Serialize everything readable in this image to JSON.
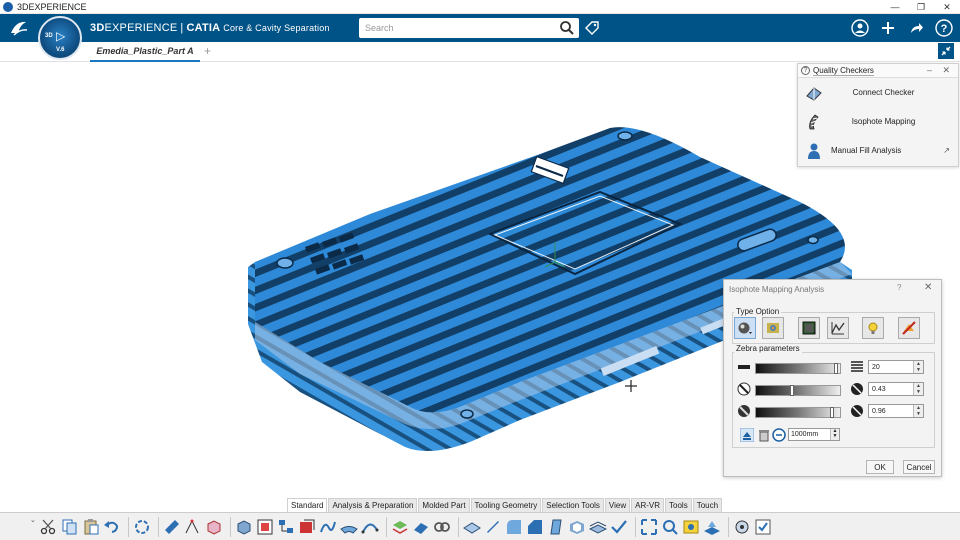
{
  "os": {
    "title": "3DEXPERIENCE",
    "controls": [
      "—",
      "❐",
      "✕"
    ]
  },
  "header": {
    "logo_text": "3DS",
    "compass": {
      "label_3d": "3D",
      "version": "V.6"
    },
    "brand_bold": "3D",
    "brand_rest": "EXPERIENCE",
    "brand_sep": "|",
    "brand_product": "CATIA",
    "app_name": "Core & Cavity Separation",
    "search_placeholder": "Search"
  },
  "tabs": {
    "document": "Emedia_Plastic_Part A",
    "add": "+"
  },
  "quality_checkers": {
    "title": "Quality Checkers",
    "help": "?",
    "controls": "– ✕",
    "items": [
      {
        "label": "Connect Checker",
        "icon": "connect-checker-icon"
      },
      {
        "label": "Isophote Mapping",
        "icon": "isophote-mapping-icon"
      },
      {
        "label": "Manual Fill Analysis",
        "icon": "manual-fill-analysis-icon",
        "external": "↗"
      }
    ]
  },
  "isophote_dialog": {
    "title": "Isophote Mapping Analysis",
    "help": "?",
    "close": "✕",
    "type_option_label": "Type Option",
    "type_option_icons": [
      "zebra-sphere-icon",
      "color-map-icon",
      "environment-mapping-icon",
      "highlight-lines-icon",
      "light-source-icon",
      "no-display-icon"
    ],
    "zebra_label": "Zebra parameters",
    "zebra_rows": [
      {
        "name": "stripe-count",
        "value": "20"
      },
      {
        "name": "stripe-ratio",
        "value": "0.43"
      },
      {
        "name": "transition",
        "value": "0.96"
      }
    ],
    "distance": "1000mm",
    "ok": "OK",
    "cancel": "Cancel"
  },
  "action_bar": {
    "tabs": [
      "Standard",
      "Analysis & Preparation",
      "Molded Part",
      "Tooling Geometry",
      "Selection Tools",
      "View",
      "AR-VR",
      "Tools",
      "Touch"
    ],
    "active_tab": "Standard"
  },
  "colors": {
    "header_bg": "#005386",
    "model_blue": "#2e8ad8",
    "stripe_dark": "#123f68",
    "accent": "#1a78c2"
  }
}
